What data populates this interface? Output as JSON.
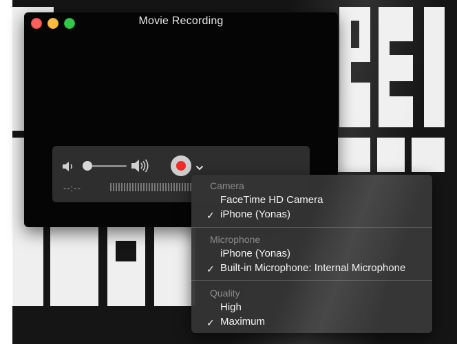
{
  "window": {
    "title": "Movie Recording"
  },
  "controls": {
    "volume_level": 0.1,
    "timecode": "--:--"
  },
  "menu": {
    "sections": [
      {
        "header": "Camera",
        "items": [
          {
            "label": "FaceTime HD Camera",
            "checked": false
          },
          {
            "label": "iPhone (Yonas)",
            "checked": true
          }
        ]
      },
      {
        "header": "Microphone",
        "items": [
          {
            "label": "iPhone (Yonas)",
            "checked": false
          },
          {
            "label": "Built-in Microphone: Internal Microphone",
            "checked": true
          }
        ]
      },
      {
        "header": "Quality",
        "items": [
          {
            "label": "High",
            "checked": false
          },
          {
            "label": "Maximum",
            "checked": true
          }
        ]
      }
    ],
    "check_glyph": "✓"
  },
  "colors": {
    "record": "#ef2d2d",
    "close": "#fc605c",
    "minimize": "#fdbc40",
    "zoom": "#34c84a"
  },
  "icons": {
    "volume_low": "speaker-low-icon",
    "volume_high": "speaker-high-icon",
    "record": "record-icon",
    "options": "chevron-down-icon"
  }
}
